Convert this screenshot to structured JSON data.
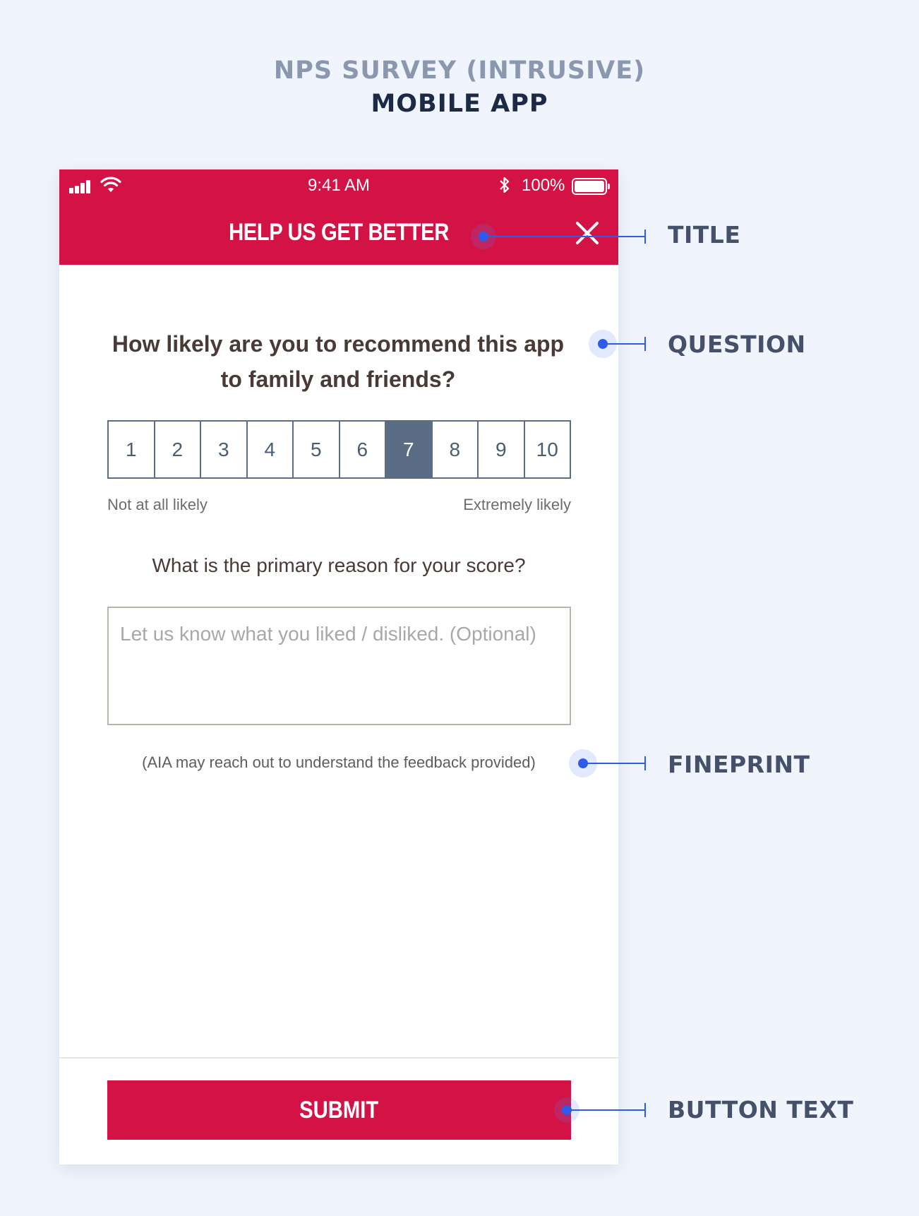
{
  "header": {
    "subtitle": "NPS SURVEY (INTRUSIVE)",
    "title": "MOBILE APP"
  },
  "status_bar": {
    "time": "9:41 AM",
    "battery": "100%"
  },
  "nav": {
    "title": "HELP US GET BETTER",
    "close_icon": "close-icon"
  },
  "survey": {
    "question": "How likely are you to recommend this app to family and friends?",
    "scale": [
      "1",
      "2",
      "3",
      "4",
      "5",
      "6",
      "7",
      "8",
      "9",
      "10"
    ],
    "selected": "7",
    "scale_low_label": "Not at all likely",
    "scale_high_label": "Extremely likely",
    "reason_question": "What is the primary reason for your score?",
    "feedback_placeholder": "Let us know what you liked / disliked. (Optional)",
    "fineprint": "(AIA may reach out to understand the feedback provided)",
    "submit_label": "SUBMIT"
  },
  "annotations": {
    "title": "TITLE",
    "question": "QUESTION",
    "fineprint": "FINEPRINT",
    "button_text": "BUTTON TEXT"
  },
  "colors": {
    "brand_red": "#d31245",
    "selected_cell": "#5a6d84",
    "annotation_blue": "#2f5bea",
    "background": "#f0f5fd"
  }
}
